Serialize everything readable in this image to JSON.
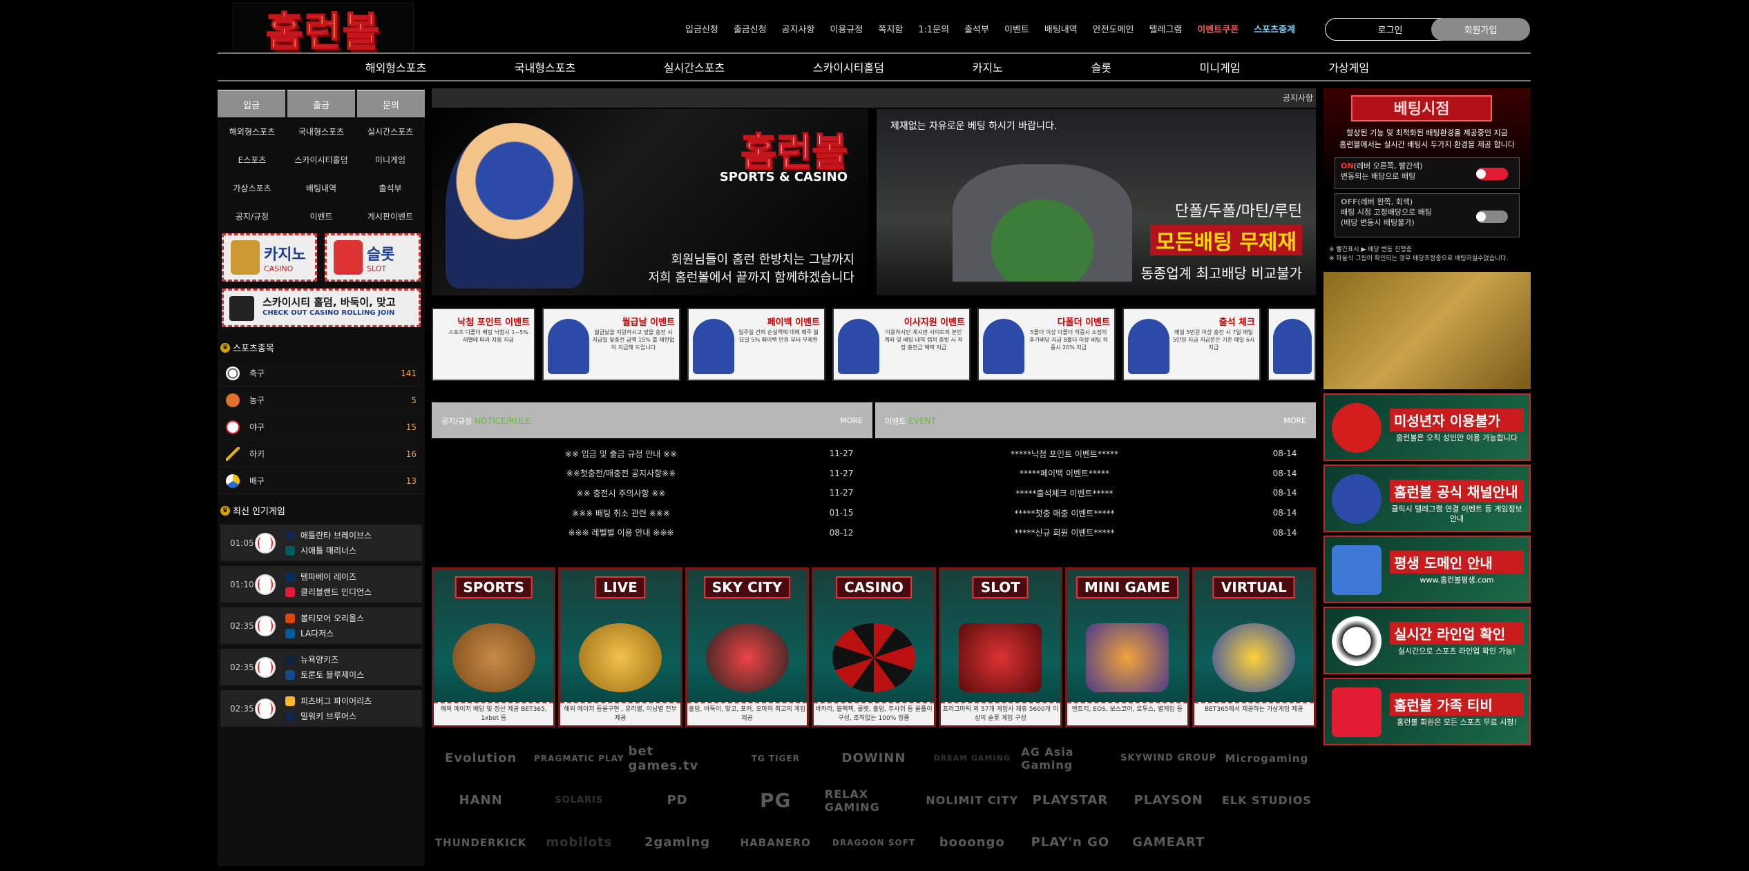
{
  "logo_text": "홈런볼",
  "top_nav": [
    "입금신청",
    "출금신청",
    "공지사항",
    "이용규정",
    "쪽지함",
    "1:1문의",
    "출석부",
    "이벤트",
    "배팅내역",
    "안전도메인",
    "텔레그램",
    "이벤트쿠폰",
    "스포츠중계"
  ],
  "login": "로그인",
  "join": "회원가입",
  "main_nav": [
    "해외형스포츠",
    "국내형스포츠",
    "실시간스포츠",
    "스카이시티홀덤",
    "카지노",
    "슬롯",
    "미니게임",
    "가상게임"
  ],
  "left": {
    "tabs": [
      "입금",
      "출금",
      "문의"
    ],
    "grid": [
      "해외형스포츠",
      "국내형스포츠",
      "실시간스포츠",
      "E스포츠",
      "스카이시티홀덤",
      "미니게임",
      "가상스포츠",
      "배팅내역",
      "출석부",
      "공지/규정",
      "이벤트",
      "게시판이벤트"
    ],
    "casino_label": "카지노",
    "casino_sub": "CASINO",
    "slot_label": "슬롯",
    "slot_sub": "SLOT",
    "skycity_title": "스카이시티 홀덤, 바둑이, 맞고",
    "skycity_sub": "CHECK OUT CASINO ROLLING JOIN",
    "sports_head": "스포츠종목",
    "sports": [
      {
        "name": "축구",
        "count": "141"
      },
      {
        "name": "농구",
        "count": "5"
      },
      {
        "name": "야구",
        "count": "15"
      },
      {
        "name": "하키",
        "count": "16"
      },
      {
        "name": "배구",
        "count": "13"
      }
    ],
    "popular_head": "최신 인기게임",
    "matches": [
      {
        "time": "01:05",
        "home": "애틀란타 브레이브스",
        "away": "시애틀 매리너스"
      },
      {
        "time": "01:10",
        "home": "템파베이 레이즈",
        "away": "클리블랜드 인디언스"
      },
      {
        "time": "02:35",
        "home": "볼티모어 오리올스",
        "away": "LA다저스"
      },
      {
        "time": "02:35",
        "home": "뉴욕양키즈",
        "away": "토론토 블루제이스"
      },
      {
        "time": "02:35",
        "home": "피츠버그 파이어리츠",
        "away": "밀워키 브루어스"
      }
    ]
  },
  "ticker": "공지사항",
  "banner_a": {
    "brand": "홈런볼",
    "sub": "SPORTS & CASINO",
    "line1": "회원님들이 홈런 한방치는 그날까지",
    "line2": "저희 홈런볼에서 끝까지 함께하겠습니다"
  },
  "banner_b": {
    "top": "제재없는 자유로운 베팅 하시기 바랍니다.",
    "line1": "단폴/두폴/마틴/루틴",
    "line2": "모든배팅 무제재",
    "line3": "동종업계 최고배당 비교불가"
  },
  "events": [
    {
      "title": "낙첨 포인트 이벤트",
      "desc": "스포츠 다폴더 배팅 낙첨시 1~5% 레벨에 따라 자동 지급"
    },
    {
      "title": "월급날 이벤트",
      "desc": "월급날을 지원하시고 맞을 충전 시 지급일 맞충전 금액 15% 를 제한없이 지급해 드립니다"
    },
    {
      "title": "페이백 이벤트",
      "desc": "일주일 간의 손실액에 대해 매주 월요일 5% 페이백 만원 부터 무제한"
    },
    {
      "title": "이사지원 이벤트",
      "desc": "이용하시던 게시판 사이트의 본인 계좌 및 배팅 내역 캡쳐 증빙 시 적정 충전금 혜택 지급"
    },
    {
      "title": "다폴더 이벤트",
      "desc": "5폴더 이상 다폴더 적중시 소정의 추가배당 지급 8폴더 이상 배팅 적중시 20% 지급"
    },
    {
      "title": "출석 체크",
      "desc": "매일 5만원 이상 충전 시 7일 매일 5만원 지급 지급문은 기준 매일 6시 지급"
    }
  ],
  "notice": {
    "title": "공지/규정",
    "sub": "NOTICE/RULE",
    "more": "MORE",
    "rows": [
      {
        "t": "※※ 입금 및 출금 규정 안내 ※※",
        "d": "11-27"
      },
      {
        "t": "※※첫충전/매충전 공지사항※※",
        "d": "11-27"
      },
      {
        "t": "※※ 충전시 주의사항 ※※",
        "d": "11-27"
      },
      {
        "t": "※※※ 배팅 취소 관련 ※※※",
        "d": "01-15"
      },
      {
        "t": "※※※ 레벨별 이용 안내 ※※※",
        "d": "08-12"
      }
    ]
  },
  "event_board": {
    "title": "이벤트",
    "sub": "EVENT",
    "more": "MORE",
    "rows": [
      {
        "t": "*****낙첨 포인트 이벤트*****",
        "d": "08-14"
      },
      {
        "t": "*****페이백 이벤트*****",
        "d": "08-14"
      },
      {
        "t": "*****출석체크 이벤트*****",
        "d": "08-14"
      },
      {
        "t": "*****첫충 매충 이벤트*****",
        "d": "08-14"
      },
      {
        "t": "*****신규 회원 이벤트*****",
        "d": "08-14"
      }
    ]
  },
  "games": [
    {
      "label": "SPORTS",
      "desc": "해외 메이저 배당 및 정산 제공 BET365, 1xbet 등"
    },
    {
      "label": "LIVE",
      "desc": "해외 메이저 등을구현 , 유리별, 이닝별 전부 제공"
    },
    {
      "label": "SKY CITY",
      "desc": "홀덤, 바둑이, 맞고, 포커, 오마하 최고의 게임 제공"
    },
    {
      "label": "CASINO",
      "desc": "바카라, 블랙잭, 룰렛, 홀덤, 주사위 등 올플이 구성, 조작없는 100% 정품"
    },
    {
      "label": "SLOT",
      "desc": "프라그마틱 외 57개 게임사 제휴 5600개 이상의 슬롯 게임 구성"
    },
    {
      "label": "MINI GAME",
      "desc": "엔트리, EOS, 보스코어, 로투스, 별게임 등"
    },
    {
      "label": "VIRTUAL",
      "desc": "BET365에서 제공하는 가상게임 제공"
    }
  ],
  "providers": [
    "Evolution",
    "PRAGMATIC PLAY",
    "bet games.tv",
    "TG TIGER",
    "DOWINN",
    "DREAM GAMING",
    "AG Asia Gaming",
    "SKYWIND GROUP",
    "Microgaming",
    "HANN",
    "SOLARIS",
    "PD",
    "PG",
    "RELAX GAMING",
    "NOLIMIT CITY",
    "PLAYSTAR",
    "PLAYSON",
    "ELK STUDIOS",
    "THUNDERKICK",
    "mobilots",
    "2gaming",
    "HABANERO",
    "DRAGOON SOFT",
    "booongo",
    "PLAY'n GO",
    "GAMEART"
  ],
  "right": {
    "title": "베팅시점",
    "desc1": "향상된 기능 및 최적화된 배팅환경을 제공중인 지금",
    "desc2": "홈런볼에서는 실시간 배팅시 두가지 환경을 제공 합니다",
    "on_head": "ON",
    "on_line1": "(레버 오른쪽, 빨간색)",
    "on_line2": "변동되는 배당으로 배팅",
    "off_head": "OFF",
    "off_line1": "(레버 왼쪽, 회색)",
    "off_line2": "배팅 시점 고정배당으로 배팅",
    "off_line3": "(배당 변동시 배팅불가)",
    "note1": "※ 빨간표시 ▶ 배당 변동 진행중",
    "note2": "※ 파울식 그림이 확인되는 경우 배당조정중으로 배팅하실수없습니다.",
    "cards": [
      {
        "h": "미성년자 이용불가",
        "s": "홈런볼은 오직 성인만 이용 가능합니다"
      },
      {
        "h": "홈런볼 공식 채널안내",
        "s": "클릭시 텔레그램 연결 이벤트 등 게임정보 안내"
      },
      {
        "h": "평생 도메인 안내",
        "s": "www.홈런볼평생.com"
      },
      {
        "h": "실시간 라인업 확인",
        "s": "실시간으로 스포츠 라인업 확인 가능!"
      },
      {
        "h": "홈런볼 가족 티비",
        "s": "홈런볼 회원은 모든 스포츠 무료 시청!"
      }
    ]
  },
  "colors": {
    "accent": "#c4161c",
    "bg": "#000000",
    "panel": "#0e0e0e",
    "count": "#f7a23b",
    "green_sub": "#5fbf2b"
  }
}
